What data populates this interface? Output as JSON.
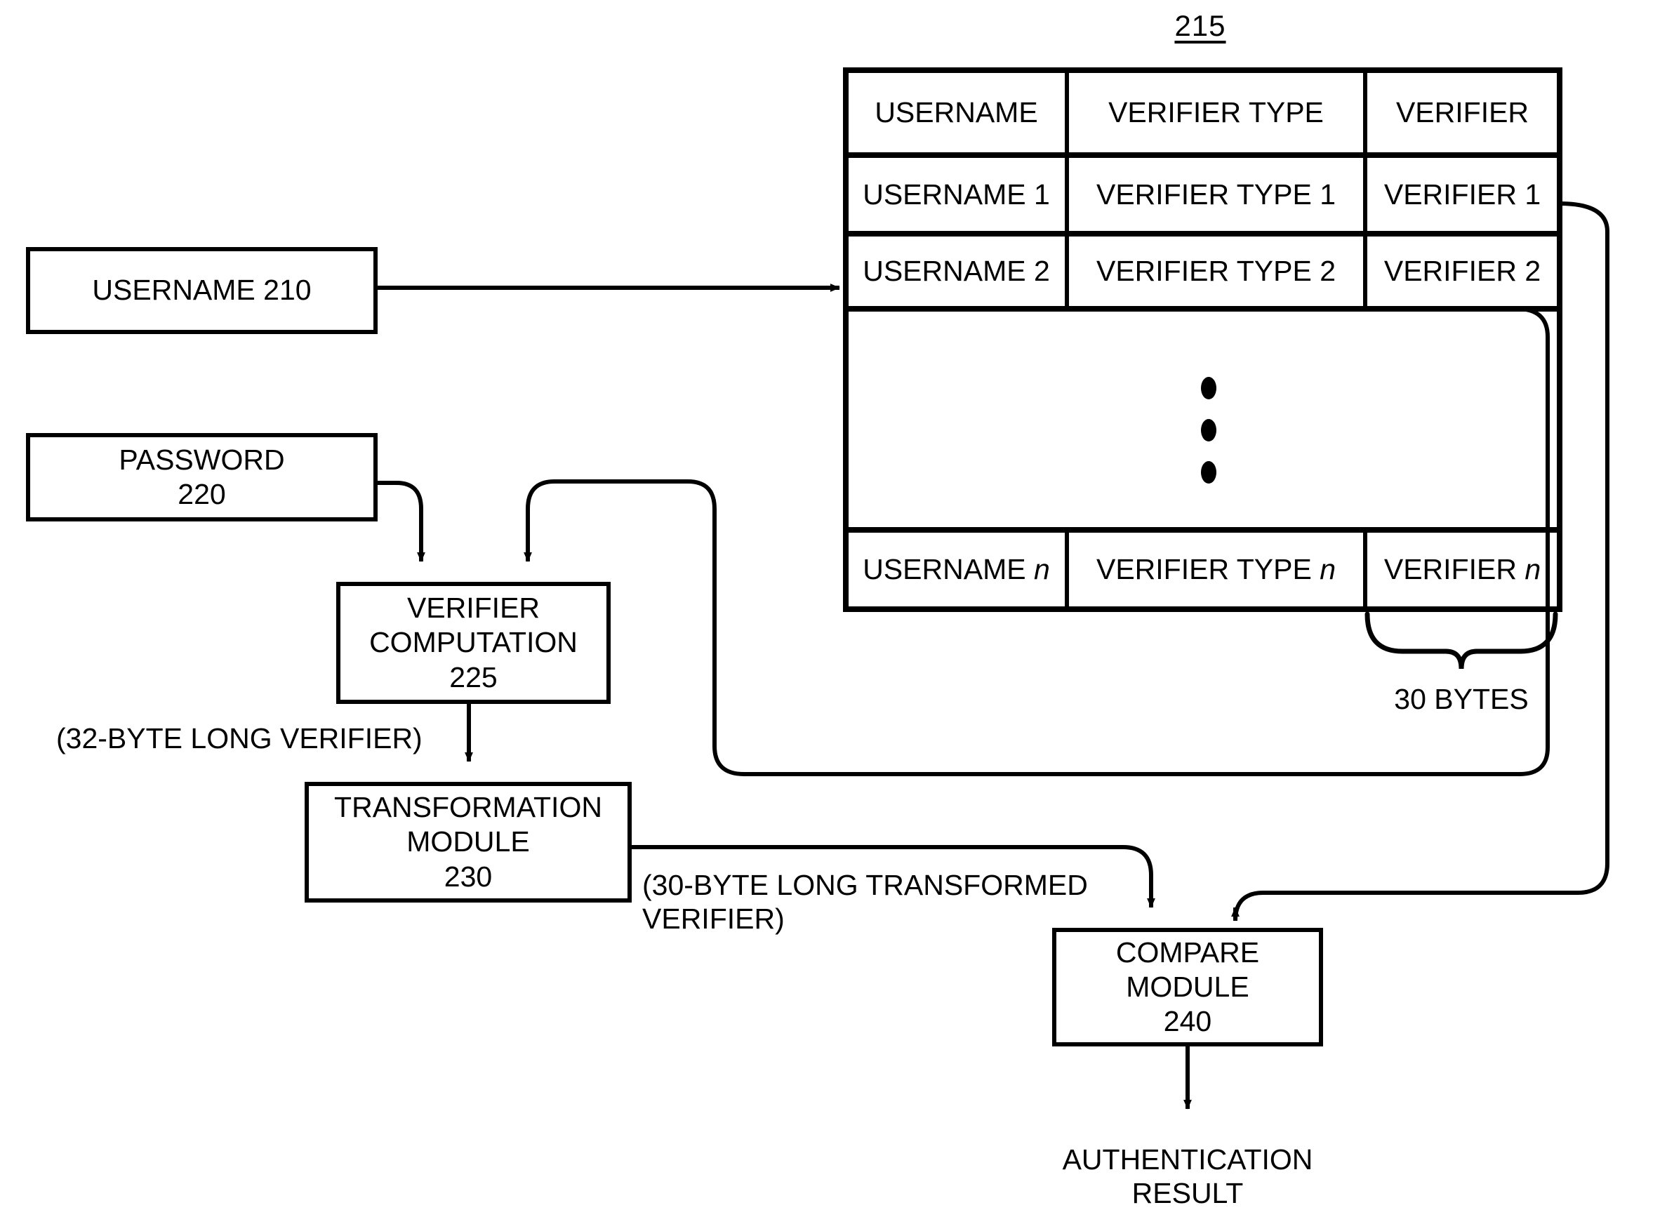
{
  "figure": {
    "reference_number": "215"
  },
  "table": {
    "name": "verifier-table",
    "columns": [
      "USERNAME",
      "VERIFIER TYPE",
      "VERIFIER"
    ],
    "rows": [
      [
        "USERNAME 1",
        "VERIFIER TYPE 1",
        "VERIFIER 1"
      ],
      [
        "USERNAME 2",
        "VERIFIER TYPE 2",
        "VERIFIER 2"
      ],
      [
        "USERNAME ",
        "VERIFIER TYPE ",
        "VERIFIER "
      ]
    ],
    "last_row_italic_suffix": "n",
    "ellipsis": "vertical-three-dots",
    "brace_label": "30 BYTES"
  },
  "blocks": {
    "username_input": "USERNAME 210",
    "password_input": "PASSWORD\n220",
    "verifier_computation": "VERIFIER\nCOMPUTATION\n225",
    "transformation_module": "TRANSFORMATION\nMODULE\n230",
    "compare_module": "COMPARE\nMODULE\n240"
  },
  "annotations": {
    "verifier_length": "(32-BYTE LONG VERIFIER)",
    "transformed_length": "(30-BYTE LONG TRANSFORMED\nVERIFIER)",
    "output": "AUTHENTICATION\nRESULT"
  },
  "colors": {
    "ink": "#000000",
    "paper": "#ffffff"
  }
}
